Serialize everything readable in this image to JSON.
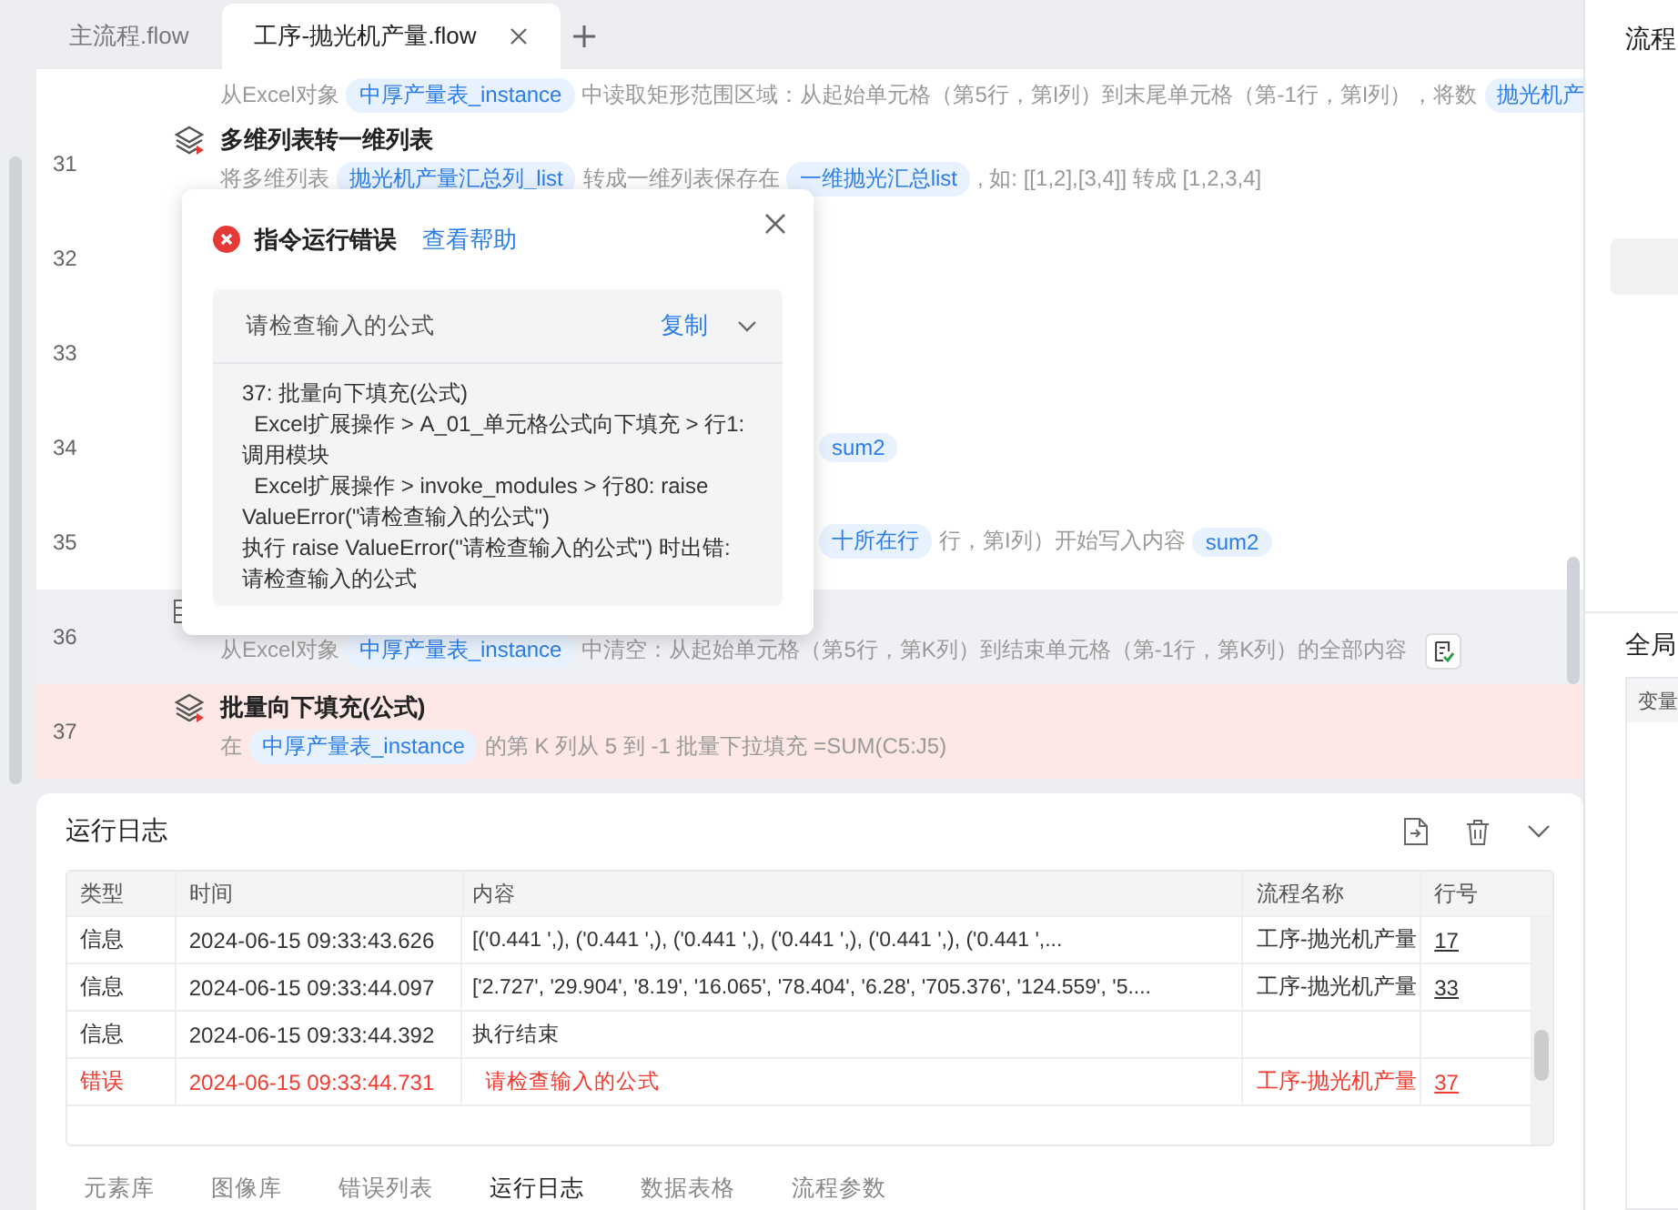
{
  "tabs": [
    {
      "label": "主流程.flow",
      "selected": false,
      "closable": false
    },
    {
      "label": "工序-抛光机产量.flow",
      "selected": true,
      "closable": true
    }
  ],
  "flow_steps": [
    {
      "selected": false,
      "error": false,
      "description": [
        {
          "kind": "text",
          "text": "从Excel对象"
        },
        {
          "kind": "var",
          "text": "中厚产量表_instance"
        },
        {
          "kind": "text",
          "text": "中读取矩形范围区域：从起始单元格（第5行，第I列）到末尾单元格（第-1行，第I列），将数"
        },
        {
          "kind": "var",
          "text": "抛光机产"
        }
      ]
    },
    {
      "line": "31",
      "selected": false,
      "error": false,
      "kind": "layers",
      "title": "多维列表转一维列表",
      "description": [
        {
          "kind": "text",
          "text": "将多维列表"
        },
        {
          "kind": "var",
          "text": "抛光机产量汇总列_list"
        },
        {
          "kind": "text",
          "text": "转成一维列表保存在"
        },
        {
          "kind": "var",
          "text": "一维抛光汇总list"
        },
        {
          "kind": "text",
          "text": ", 如: [[1,2],[3,4]] 转成 [1,2,3,4]"
        }
      ]
    },
    {
      "line": "32",
      "selected": false,
      "error": false
    },
    {
      "line": "33",
      "selected": false,
      "error": false
    },
    {
      "line": "34",
      "selected": false,
      "error": false,
      "description": [
        {
          "kind": "var",
          "text": "sum2"
        }
      ]
    },
    {
      "line": "35",
      "selected": false,
      "error": false,
      "description": [
        {
          "kind": "var",
          "text": "十所在行"
        },
        {
          "kind": "text",
          "text": "行，第I列）开始写入内容"
        },
        {
          "kind": "var",
          "text": "sum2"
        }
      ]
    },
    {
      "line": "36",
      "selected": true,
      "error": false,
      "kind": "table",
      "description": [
        {
          "kind": "text",
          "text": "从Excel对象"
        },
        {
          "kind": "var",
          "text": "中厚产量表_instance"
        },
        {
          "kind": "text",
          "text": "中清空：从起始单元格（第5行，第K列）到结束单元格（第-1行，第K列）的全部内容"
        }
      ],
      "note": true
    },
    {
      "line": "37",
      "selected": false,
      "error": true,
      "kind": "layers",
      "title": "批量向下填充(公式)",
      "description": [
        {
          "kind": "text",
          "text": "在"
        },
        {
          "kind": "var",
          "text": "中厚产量表_instance"
        },
        {
          "kind": "text",
          "text": "的第 K 列从 5 到 -1 批量下拉填充 =SUM(C5:J5)"
        }
      ]
    }
  ],
  "error_popup": {
    "title": "指令运行错误",
    "help_link": "查看帮助",
    "message": "请检查输入的公式",
    "copy_link": "复制",
    "expanded": true,
    "details": [
      "37: 批量向下填充(公式)",
      "  Excel扩展操作 > A_01_单元格公式向下填充 > 行1: 调用模块",
      "  Excel扩展操作 > invoke_modules > 行80: raise ValueError(\"请检查输入的公式\")",
      "执行 raise ValueError(\"请检查输入的公式\") 时出错: 请检查输入的公式"
    ]
  },
  "log_panel": {
    "title": "运行日志",
    "columns": [
      "类型",
      "时间",
      "内容",
      "流程名称",
      "行号"
    ],
    "rows": [
      {
        "kind": "info",
        "type": "信息",
        "time": "2024-06-15 09:33:43.626",
        "content": "[('0.441 ',), ('0.441 ',), ('0.441 ',), ('0.441 ',), ('0.441 ',), ('0.441 ',...",
        "flow": "工序-抛光机产量",
        "line": "17"
      },
      {
        "kind": "info",
        "type": "信息",
        "time": "2024-06-15 09:33:44.097",
        "content": "['2.727', '29.904', '8.19', '16.065', '78.404', '6.28', '705.376', '124.559', '5....",
        "flow": "工序-抛光机产量",
        "line": "33"
      },
      {
        "kind": "info",
        "type": "信息",
        "time": "2024-06-15 09:33:44.392",
        "content": "执行结束"
      },
      {
        "kind": "error",
        "type": "错误",
        "time": "2024-06-15 09:33:44.731",
        "content": "请检查输入的公式",
        "flow": "工序-抛光机产量",
        "line": "37"
      }
    ]
  },
  "bottom_tabs": [
    {
      "label": "元素库",
      "selected": false
    },
    {
      "label": "图像库",
      "selected": false
    },
    {
      "label": "错误列表",
      "selected": false
    },
    {
      "label": "运行日志",
      "selected": true
    },
    {
      "label": "数据表格",
      "selected": false
    },
    {
      "label": "流程参数",
      "selected": false
    }
  ],
  "right_panel": {
    "title": "流程",
    "section": "全局",
    "column": "变量"
  }
}
